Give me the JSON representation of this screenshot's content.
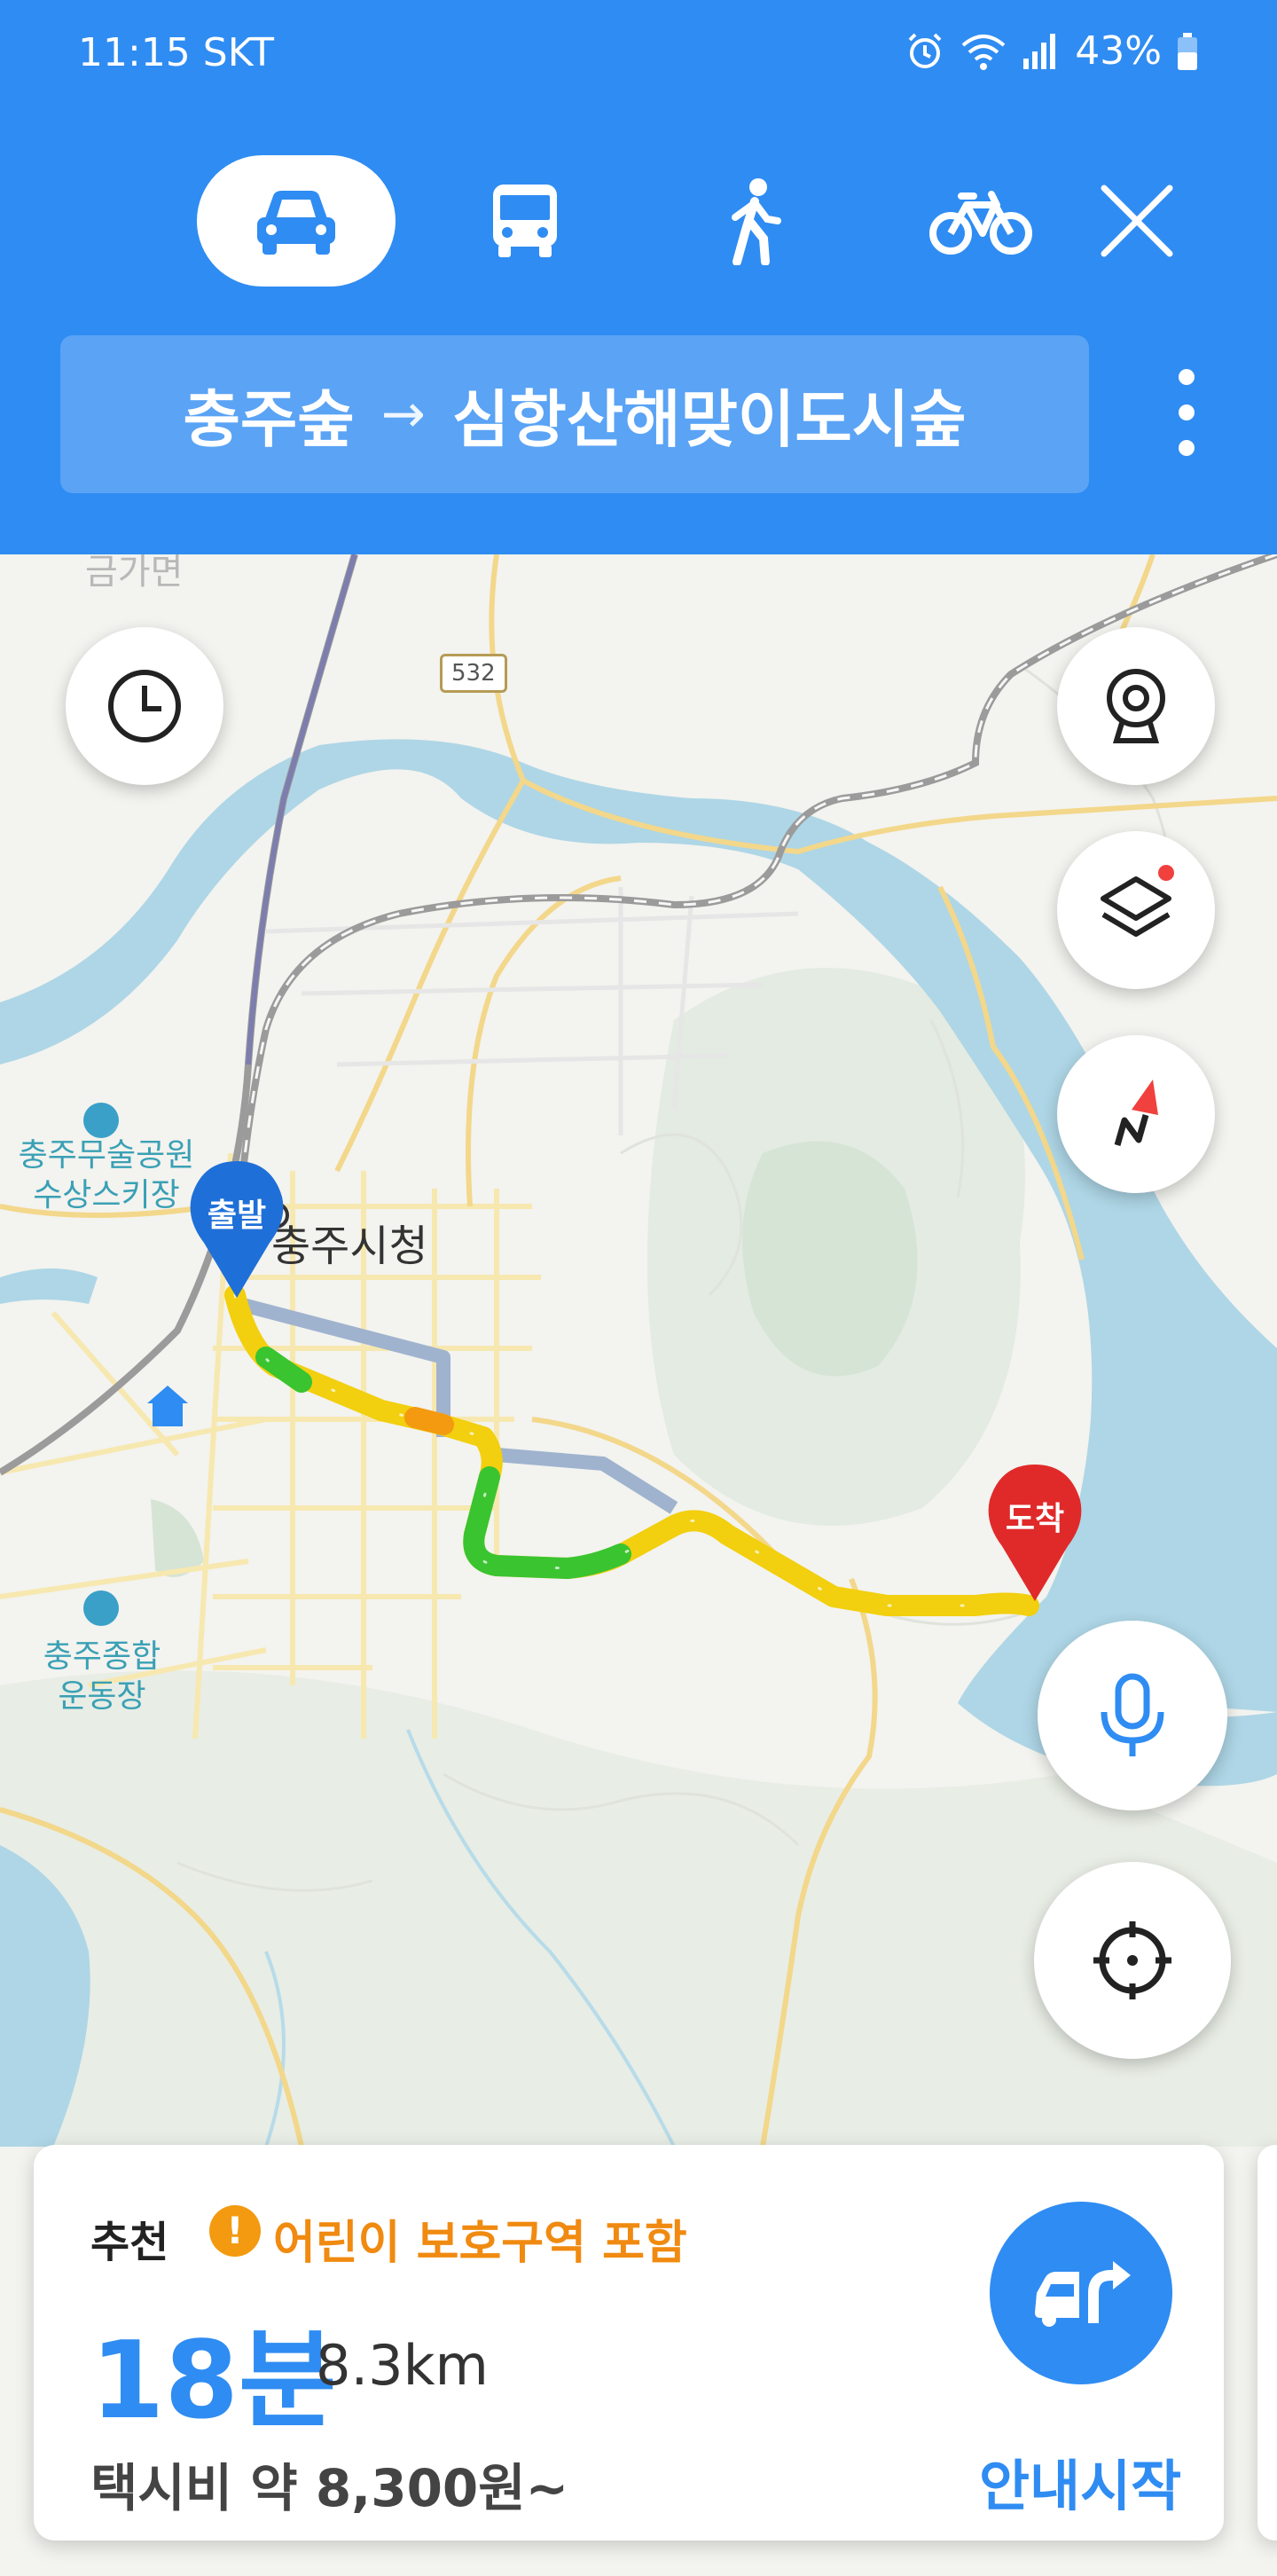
{
  "status": {
    "time": "11:15 SKT",
    "battery": "43%"
  },
  "modes": [
    {
      "name": "car",
      "icon": "car-icon",
      "active": true
    },
    {
      "name": "bus",
      "icon": "bus-icon",
      "active": false
    },
    {
      "name": "walk",
      "icon": "walk-icon",
      "active": false
    },
    {
      "name": "bike",
      "icon": "bike-icon",
      "active": false
    }
  ],
  "route": {
    "origin": "충주숲",
    "arrow": "→",
    "destination": "심항산해맞이도시숲"
  },
  "map": {
    "faded_label": "금가면",
    "road_number": "532",
    "city_hall": "충주시청",
    "place_1": "충주무술공원\n수상스키장",
    "place_2": "충주종합\n운동장",
    "start_pin": "출발",
    "end_pin": "도착"
  },
  "card": {
    "recommend": "추천",
    "warning_icon": "!",
    "warning": "어린이 보호구역 포함",
    "time": "18분",
    "distance": "8.3km",
    "fare": "택시비 약 8,300원~",
    "start_label": "안내시작"
  },
  "colors": {
    "header": "#2f8cf2",
    "route_yellow": "#f2cf0f",
    "route_green": "#3ac430",
    "route_orange": "#f39a10",
    "warning": "#f08a10"
  }
}
